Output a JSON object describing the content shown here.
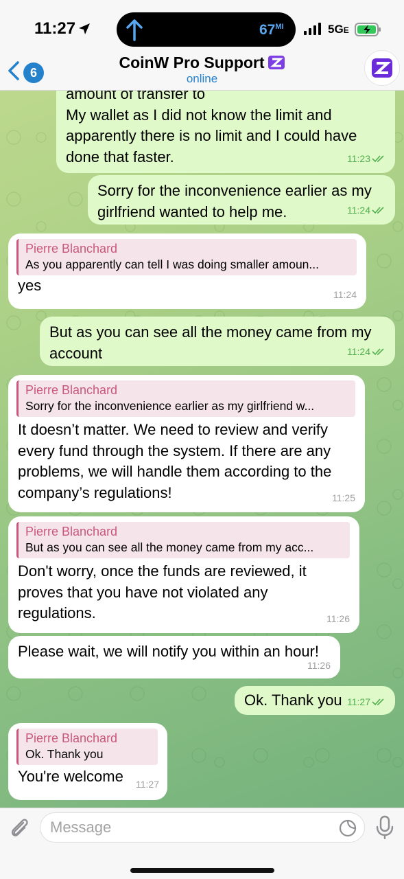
{
  "status_bar": {
    "time": "11:27",
    "temperature": "67",
    "temperature_unit": "MI",
    "network": "5G",
    "network_suffix": "E"
  },
  "header": {
    "back_count": "6",
    "title": "CoinW Pro Support",
    "status": "online"
  },
  "messages": [
    {
      "type": "out",
      "text": "amount of transfer to\nMy wallet as I did not know the limit and apparently there is no limit and I could have done that faster.",
      "time": "11:23"
    },
    {
      "type": "out",
      "text": "Sorry for the inconvenience earlier as my girlfriend wanted to help me.",
      "time": "11:24"
    },
    {
      "type": "in",
      "reply_name": "Pierre Blanchard",
      "reply_text": "As you apparently can tell I was doing smaller amoun...",
      "text": "yes",
      "time": "11:24"
    },
    {
      "type": "out",
      "text": "But as you can see all the money came from my account",
      "time": "11:24"
    },
    {
      "type": "in",
      "reply_name": "Pierre Blanchard",
      "reply_text": "Sorry for the inconvenience earlier as my girlfriend w...",
      "text": "It doesn’t matter. We need to review and verify every fund through the system. If there are any problems, we will handle them according to the company’s regulations!",
      "time": "11:25"
    },
    {
      "type": "in",
      "reply_name": "Pierre Blanchard",
      "reply_text": "But as you can see all the money came from my acc...",
      "text": "Don't worry, once the funds are reviewed, it proves that you have not violated any regulations.",
      "time": "11:26"
    },
    {
      "type": "in",
      "text": "Please wait, we will notify you within an hour!",
      "time": "11:26"
    },
    {
      "type": "out",
      "text": "Ok. Thank you",
      "time": "11:27"
    },
    {
      "type": "in",
      "reply_name": "Pierre Blanchard",
      "reply_text": "Ok. Thank you",
      "text": "You're welcome",
      "time": "11:27"
    }
  ],
  "input": {
    "placeholder": "Message"
  },
  "colors": {
    "accent": "#2481cc",
    "outgoing_bubble": "#e0f9c8",
    "incoming_bubble": "#ffffff",
    "reply_name": "#c9577b",
    "tick_color": "#4fae4e"
  }
}
